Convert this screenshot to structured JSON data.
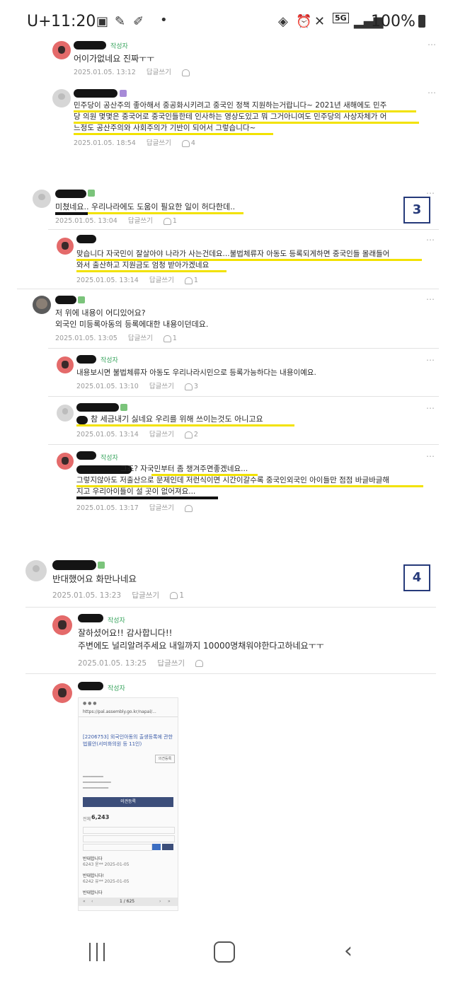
{
  "status_bar": {
    "carrier": "U+",
    "time": "11:20",
    "battery": "100%",
    "network": "5G"
  },
  "labels": {
    "author_badge": "작성자",
    "reply": "답글쓰기"
  },
  "section1": {
    "comments": [
      {
        "text": "어이가없네요 진짜ㅜㅜ",
        "date": "2025.01.05. 13:12",
        "likes": ""
      },
      {
        "lines": [
          "민주당이 공산주의 좋아해서 중공화시키려고 중국인 정책 지원하는거랍니다~ 2021년 새해에도 민주",
          "당 의원 몇몇은 중국어로 중국인들한테 인사하는 영상도있고 뭐 그거아니여도 민주당의 사상자체가 어",
          "느정도 공산주의와 사회주의가 기반이 되어서 그렇습니다~"
        ],
        "date": "2025.01.05. 18:54",
        "likes": "4"
      }
    ]
  },
  "section3": {
    "number": "3",
    "comments": [
      {
        "text": "미쳤네요.. 우리나라에도 도움이 필요한 일이 허다한데..",
        "date": "2025.01.05. 13:04",
        "likes": "1"
      },
      {
        "lines": [
          "맞습니다 자국민이 잘살아야 나라가 사는건데요...불법체류자 아동도 등록되게하면 중국인들 몰래들어",
          "와서 출산하고 지원금도 엄청 받아가겠네요"
        ],
        "date": "2025.01.05. 13:14",
        "likes": "1"
      },
      {
        "lines": [
          "저 위에 내용이 어디있어요?",
          "외국인 미등록아동의 등록에대한 내용이던데요."
        ],
        "date": "2025.01.05. 13:05",
        "likes": "1"
      },
      {
        "text": "내용보시면 불법체류자 아동도 우리나라시민으로 등록가능하다는 내용이예요.",
        "date": "2025.01.05. 13:10",
        "likes": "3"
      },
      {
        "text": "참 세금내기 싫네요 우리를 위해 쓰이는것도 아니고요",
        "date": "2025.01.05. 13:14",
        "likes": "2"
      },
      {
        "lines": [
          "그죠? 자국민부터 좀 챙겨주면좋겠네요...",
          "그렇지않아도 저출산으로 문제인데 저런식이면 시간이갈수록 중국인외국인 아이들만 점점 바글바글해",
          "지고 우리아이들이 설 곳이 없어져요..."
        ],
        "date": "2025.01.05. 13:17",
        "likes": ""
      }
    ]
  },
  "section4": {
    "number": "4",
    "comments": [
      {
        "text": "반대했어요 화만나네요",
        "date": "2025.01.05. 13:23",
        "likes": "1"
      },
      {
        "lines": [
          "잘하셨어요!! 감사합니다!!",
          "주변에도 널리알려주세요 내일까지 10000명채워야한다고하네요ㅜㅜ"
        ],
        "date": "2025.01.05. 13:25",
        "likes": ""
      }
    ],
    "embedded_screenshot": {
      "url": "https://pal.assembly.go.kr/napal/...",
      "title_lines": [
        "[2206753] 외국인아동의 출생등록에 관한",
        "법률안(서미화의원 등 11인)"
      ],
      "button": "의견등록",
      "count": "6,243",
      "count_label": "전체",
      "list_items": [
        {
          "title": "반대합니다",
          "meta": "6243  윤**   2025-01-05"
        },
        {
          "title": "반대합니다!",
          "meta": "6242  유**   2025-01-05"
        },
        {
          "title": "반대합니다",
          "meta": ""
        }
      ],
      "pager": "1 / 625"
    }
  },
  "colors": {
    "highlight": "#f2e200",
    "badge_green": "#3aa55f",
    "number_box": "#263a7a",
    "meta_gray": "#9a9a9a"
  }
}
